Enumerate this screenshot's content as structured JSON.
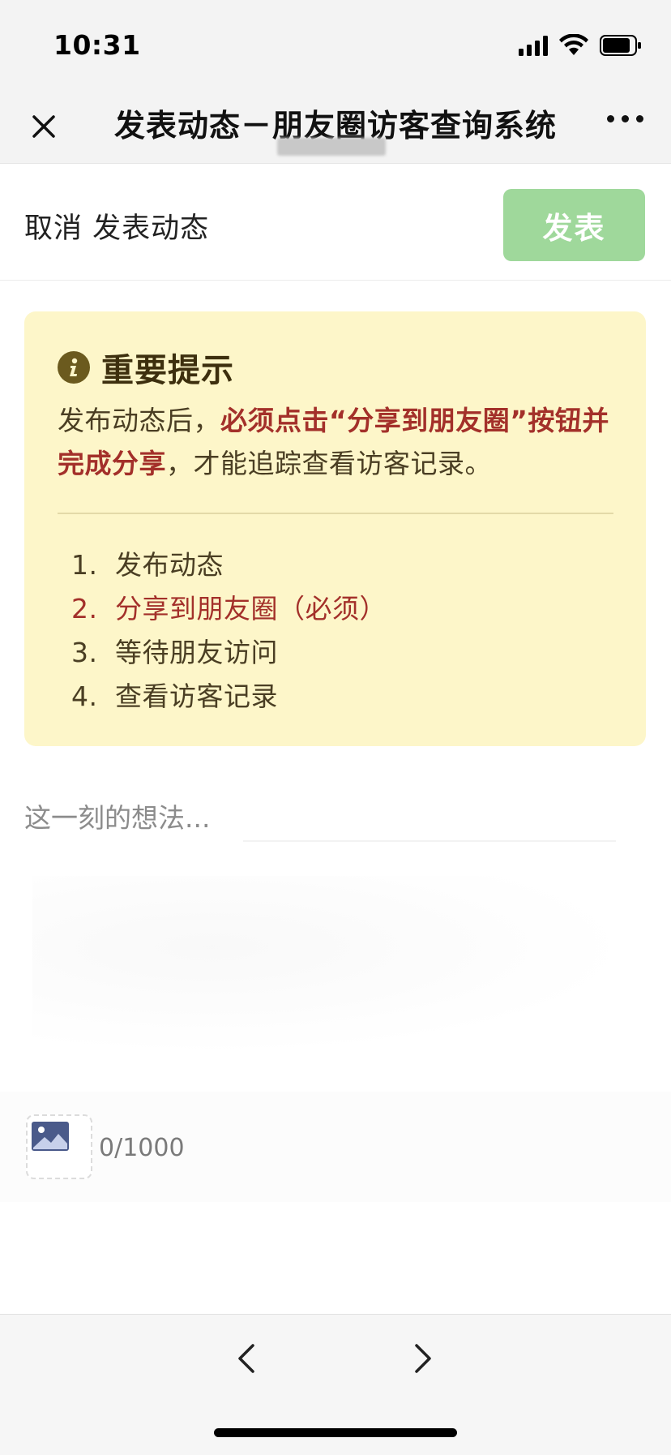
{
  "status_bar": {
    "time": "10:31"
  },
  "nav": {
    "title": "发表动态－朋友圈访客查询系统"
  },
  "compose": {
    "title": "取消 发表动态",
    "publish_label": "发表"
  },
  "notice": {
    "title": "重要提示",
    "body_part1": "发布动态后，",
    "body_strong1": "必须点击“分享到朋友圈”按钮并完成分享",
    "body_part2": "，才能追踪查看访客记录。",
    "steps": [
      {
        "num": "1.",
        "text": "发布动态",
        "highlight": false
      },
      {
        "num": "2.",
        "text": "分享到朋友圈（必须）",
        "highlight": true
      },
      {
        "num": "3.",
        "text": "等待朋友访问",
        "highlight": false
      },
      {
        "num": "4.",
        "text": "查看访客记录",
        "highlight": false
      }
    ]
  },
  "editor": {
    "placeholder": "这一刻的想法...",
    "char_count": "0/1000"
  },
  "colors": {
    "publish_button": "#9fd89b",
    "notice_background": "#fdf6c9",
    "notice_emphasis": "#a3302a"
  },
  "icons": {
    "close": "close-icon",
    "more": "more-icon",
    "info": "info-icon",
    "picture": "picture-icon",
    "back": "chevron-left-icon",
    "forward": "chevron-right-icon"
  }
}
